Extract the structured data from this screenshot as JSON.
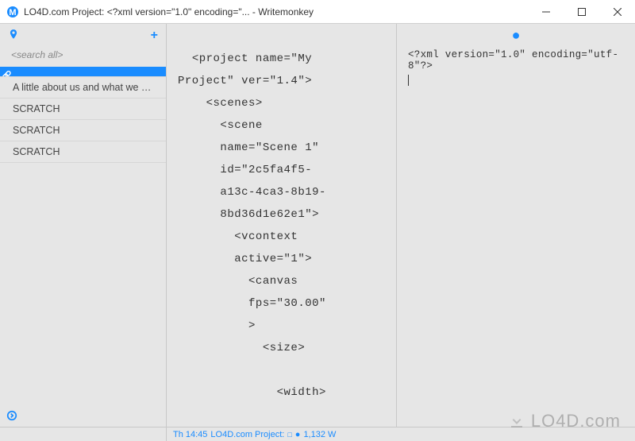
{
  "window": {
    "title": "LO4D.com Project:  <?xml version=\"1.0\" encoding=\"... - Writemonkey"
  },
  "sidebar": {
    "search_placeholder": "<search all>",
    "items": [
      {
        "label": "",
        "active": true
      },
      {
        "label": "A little about us and what we …",
        "active": false
      },
      {
        "label": "SCRATCH",
        "active": false
      },
      {
        "label": "SCRATCH",
        "active": false
      },
      {
        "label": "SCRATCH",
        "active": false
      }
    ]
  },
  "center": {
    "content": "  <project name=\"My\nProject\" ver=\"1.4\">\n    <scenes>\n      <scene\n      name=\"Scene 1\"\n      id=\"2c5fa4f5-\n      a13c-4ca3-8b19-\n      8bd36d1e62e1\">\n        <vcontext\n        active=\"1\">\n          <canvas\n          fps=\"30.00\"\n          >\n            <size>\n\n              <width>"
  },
  "right": {
    "content": "<?xml version=\"1.0\" encoding=\"utf-8\"?>"
  },
  "statusbar": {
    "time_label": "Th 14:45",
    "project_label": "LO4D.com Project:",
    "word_count": "1,132 W"
  },
  "watermark": {
    "text": "LO4D.com"
  }
}
